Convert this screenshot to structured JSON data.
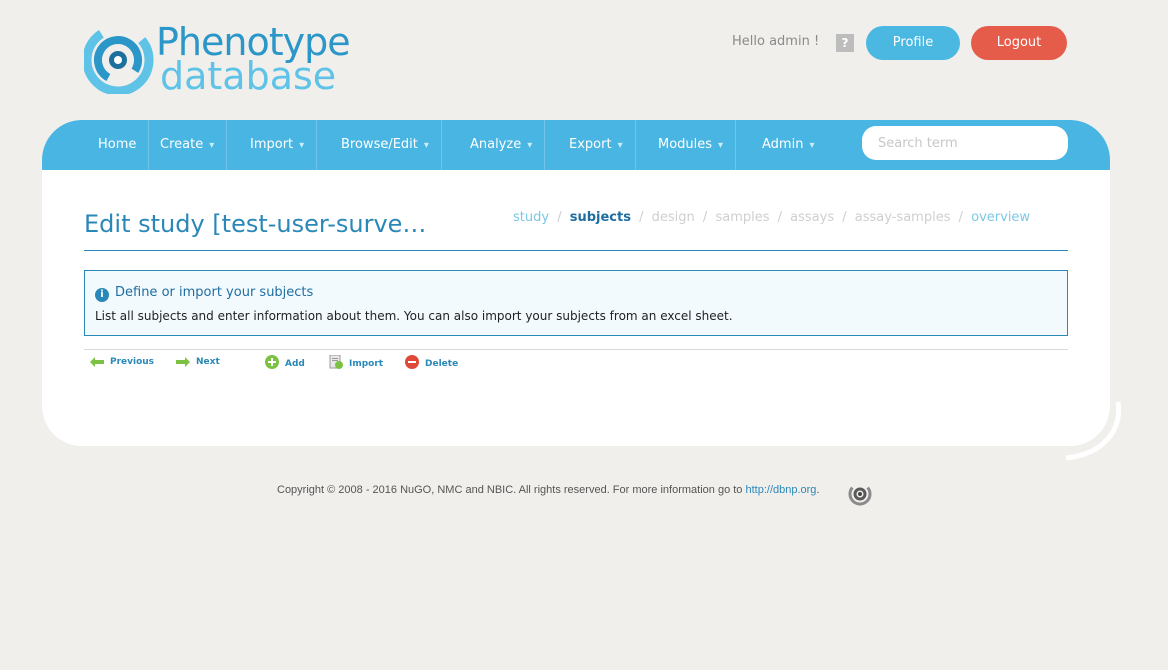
{
  "header": {
    "logo": {
      "line1": "Phenotype",
      "line2": "database"
    },
    "greeting": "Hello admin !",
    "help_label": "?",
    "profile_label": "Profile",
    "logout_label": "Logout"
  },
  "nav": {
    "items": [
      {
        "label": "Home",
        "dropdown": false
      },
      {
        "label": "Create",
        "dropdown": true
      },
      {
        "label": "Import",
        "dropdown": true
      },
      {
        "label": "Browse/Edit",
        "dropdown": true
      },
      {
        "label": "Analyze",
        "dropdown": true
      },
      {
        "label": "Export",
        "dropdown": true
      },
      {
        "label": "Modules",
        "dropdown": true
      },
      {
        "label": "Admin",
        "dropdown": true
      }
    ],
    "caret": "▾",
    "search_placeholder": "Search term"
  },
  "main": {
    "title": "Edit study [test-user-surve…",
    "steps": [
      {
        "label": "study",
        "state": "link"
      },
      {
        "label": "subjects",
        "state": "active"
      },
      {
        "label": "design",
        "state": "inactive"
      },
      {
        "label": "samples",
        "state": "inactive"
      },
      {
        "label": "assays",
        "state": "inactive"
      },
      {
        "label": "assay-samples",
        "state": "inactive"
      },
      {
        "label": "overview",
        "state": "link"
      }
    ],
    "step_separator": "/",
    "info": {
      "heading": "Define or import your subjects",
      "body": "List all subjects and enter information about them. You can also import your subjects from an excel sheet."
    },
    "actions": {
      "previous": "Previous",
      "next": "Next",
      "add": "Add",
      "import": "Import",
      "delete": "Delete"
    }
  },
  "footer": {
    "text": "Copyright © 2008 - 2016 NuGO, NMC and NBIC. All rights reserved. For more information go to",
    "link": "http://dbnp.org",
    "tail": "."
  },
  "colors": {
    "brand": "#49b5e2",
    "brand_dark": "#2a88b8",
    "logout": "#e65c4b",
    "background": "#f1efec"
  }
}
